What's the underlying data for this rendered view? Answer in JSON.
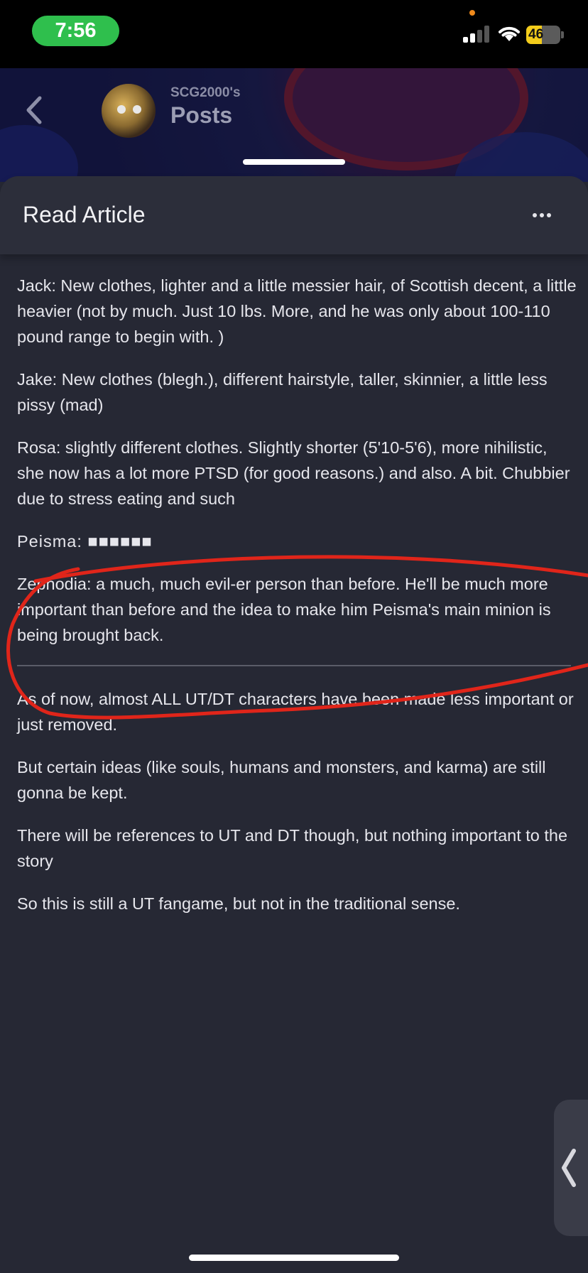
{
  "status_bar": {
    "time": "7:56",
    "battery_level": "46",
    "battery_fraction": 0.46,
    "charging": true
  },
  "header": {
    "owner": "SCG2000's",
    "title": "Posts"
  },
  "sheet": {
    "title": "Read Article"
  },
  "article": {
    "paragraphs_top": [
      "Jack: New clothes, lighter and a little messier hair, of Scottish decent, a little heavier (not by much. Just 10 lbs. More, and he was only about 100-110 pound range to begin with. )",
      "Jake: New clothes (blegh.), different hairstyle, taller, skinnier, a little less pissy (mad)",
      "Rosa: slightly different clothes. Slightly shorter (5'10-5'6), more nihilistic, she now has a lot more PTSD (for good reasons.) and also. A bit. Chubbier due to stress eating and such",
      "Peisma: ■■■■■■",
      "Zephodia: a much, much evil-er person than before. He'll be much more important than before and the idea to make him Peisma's main minion is being brought back."
    ],
    "paragraphs_bottom": [
      "As of now, almost ALL UT/DT characters have been made less important or just removed.",
      "But certain ideas (like souls, humans and monsters, and karma) are still gonna be kept.",
      "There will be references to UT and DT though, but nothing important to the story",
      "So this is still a UT fangame, but not in the traditional sense."
    ]
  },
  "annotation_color": "#e0251a",
  "colors": {
    "background": "#262834",
    "time_pill": "#2fbf4d",
    "battery": "#f3cc1b"
  },
  "icons": {
    "back": "chevron-left-icon",
    "more": "ellipsis-icon",
    "side_tab": "chevron-left-icon"
  }
}
